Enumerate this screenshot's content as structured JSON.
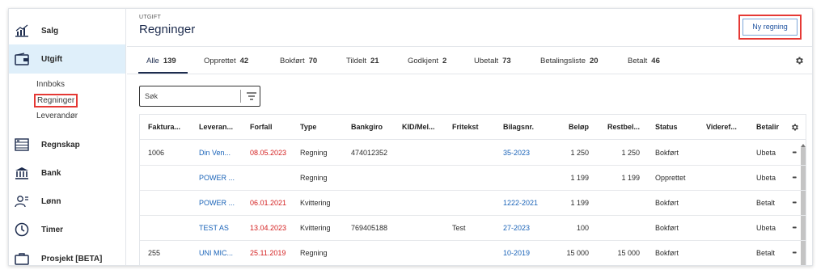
{
  "sidebar": {
    "items": [
      {
        "label": "Salg",
        "icon": "bar-chart-icon"
      },
      {
        "label": "Utgift",
        "icon": "wallet-icon"
      },
      {
        "label": "Regnskap",
        "icon": "ledger-icon"
      },
      {
        "label": "Bank",
        "icon": "bank-icon"
      },
      {
        "label": "Lønn",
        "icon": "payroll-icon"
      },
      {
        "label": "Timer",
        "icon": "clock-icon"
      },
      {
        "label": "Prosjekt [BETA]",
        "icon": "briefcase-icon"
      }
    ],
    "subitems": [
      "Innboks",
      "Regninger",
      "Leverandør"
    ]
  },
  "header": {
    "eyebrow": "UTGIFT",
    "title": "Regninger",
    "new_button": "Ny regning"
  },
  "tabs": [
    {
      "label": "Alle",
      "count": "139"
    },
    {
      "label": "Opprettet",
      "count": "42"
    },
    {
      "label": "Bokført",
      "count": "70"
    },
    {
      "label": "Tildelt",
      "count": "21"
    },
    {
      "label": "Godkjent",
      "count": "2"
    },
    {
      "label": "Ubetalt",
      "count": "73"
    },
    {
      "label": "Betalingsliste",
      "count": "20"
    },
    {
      "label": "Betalt",
      "count": "46"
    }
  ],
  "search": {
    "placeholder": "Søk"
  },
  "table": {
    "columns": [
      "Faktura...",
      "Leveran...",
      "Forfall",
      "Type",
      "Bankgiro",
      "KID/Mel...",
      "Fritekst",
      "Bilagsnr.",
      "Beløp",
      "Restbel...",
      "Status",
      "Viderеf...",
      "Betalir"
    ],
    "rows": [
      {
        "faktura": "1006",
        "leverandor": "Din Ven...",
        "forfall": "08.05.2023",
        "type": "Regning",
        "bankgiro": "474012352",
        "kid": "",
        "fritekst": "",
        "bilag": "35-2023",
        "belop": "1 250",
        "rest": "1 250",
        "status": "Bokført",
        "videre": "",
        "betaling": "Ubeta"
      },
      {
        "faktura": "",
        "leverandor": "POWER ...",
        "forfall": "",
        "type": "Regning",
        "bankgiro": "",
        "kid": "",
        "fritekst": "",
        "bilag": "",
        "belop": "1 199",
        "rest": "1 199",
        "status": "Opprettet",
        "videre": "",
        "betaling": "Ubeta"
      },
      {
        "faktura": "",
        "leverandor": "POWER ...",
        "forfall": "06.01.2021",
        "type": "Kvittering",
        "bankgiro": "",
        "kid": "",
        "fritekst": "",
        "bilag": "1222-2021",
        "belop": "1 199",
        "rest": "",
        "status": "Bokført",
        "videre": "",
        "betaling": "Betalt"
      },
      {
        "faktura": "",
        "leverandor": "TEST AS",
        "forfall": "13.04.2023",
        "type": "Kvittering",
        "bankgiro": "769405188",
        "kid": "",
        "fritekst": "Test",
        "bilag": "27-2023",
        "belop": "100",
        "rest": "",
        "status": "Bokført",
        "videre": "",
        "betaling": "Ubeta"
      },
      {
        "faktura": "255",
        "leverandor": "UNI MIC...",
        "forfall": "25.11.2019",
        "type": "Regning",
        "bankgiro": "",
        "kid": "",
        "fritekst": "",
        "bilag": "10-2019",
        "belop": "15 000",
        "rest": "15 000",
        "status": "Bokført",
        "videre": "",
        "betaling": "Betalt"
      }
    ]
  },
  "colors": {
    "accent": "#1d2c4e",
    "link": "#1a63b8",
    "overdue": "#d42020",
    "highlight": "#e53935",
    "active_nav": "#dfeffa"
  }
}
